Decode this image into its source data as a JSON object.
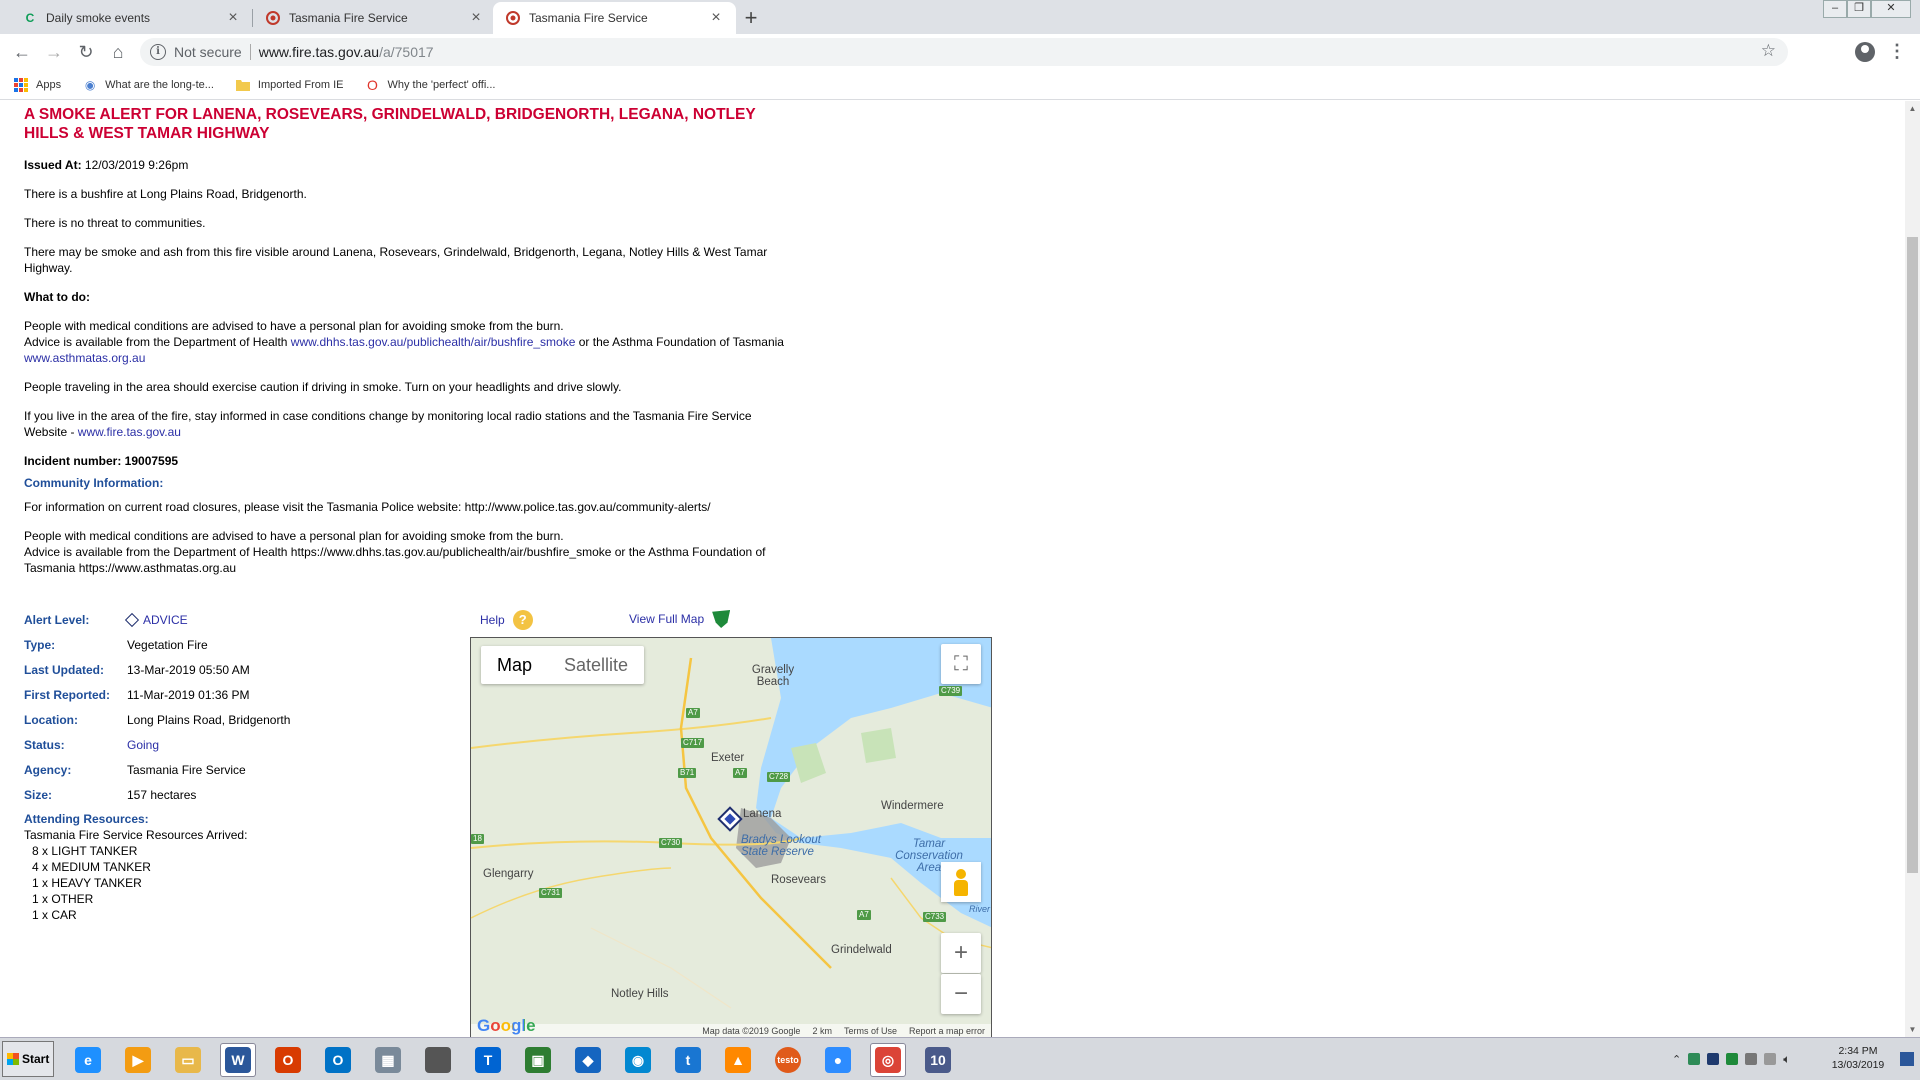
{
  "browser": {
    "tabs": [
      {
        "title": "Daily smoke events",
        "favicon": "C",
        "favicon_color": "#0f9d58",
        "active": false
      },
      {
        "title": "Tasmania Fire Service",
        "favicon": "tfs-icon",
        "favicon_color": "#c0392b",
        "active": false
      },
      {
        "title": "Tasmania Fire Service",
        "favicon": "tfs-icon",
        "favicon_color": "#c0392b",
        "active": true
      }
    ],
    "new_tab": "+",
    "security_text": "Not secure",
    "url_host": "www.fire.tas.gov.au",
    "url_path": "/a/75017",
    "bookmarks": [
      {
        "label": "Apps",
        "icon": "apps-grid-icon"
      },
      {
        "label": "What are the long-te...",
        "icon": "globe-icon"
      },
      {
        "label": "Imported From IE",
        "icon": "folder-icon"
      },
      {
        "label": "Why the 'perfect' offi...",
        "icon": "opera-icon"
      }
    ]
  },
  "alert": {
    "title": "A SMOKE ALERT FOR LANENA, ROSEVEARS, GRINDELWALD, BRIDGENORTH, LEGANA, NOTLEY HILLS & WEST TAMAR HIGHWAY",
    "issued_label": "Issued At:",
    "issued_value": "12/03/2019 9:26pm",
    "para1": "There is a bushfire at Long Plains Road, Bridgenorth.",
    "para2": "There is no threat to communities.",
    "para3": "There may be smoke and ash from this fire visible around Lanena, Rosevears, Grindelwald, Bridgenorth, Legana, Notley Hills & West Tamar Highway.",
    "what_to_do": "What to do:",
    "medical_1": "People with medical conditions are advised to have a personal plan for avoiding smoke from the burn.",
    "medical_2a": "Advice is available from the Department of Health ",
    "medical_link1": "www.dhhs.tas.gov.au/publichealth/air/bushfire_smoke",
    "medical_2b": " or the Asthma Foundation of Tasmania ",
    "medical_link2": "www.asthmatas.org.au",
    "travel": "People traveling in the area should exercise caution if driving in smoke. Turn on your headlights and drive slowly.",
    "live_a": "If you live in the area of the fire, stay informed in case conditions change by monitoring local radio stations and the Tasmania Fire Service Website - ",
    "live_link": "www.fire.tas.gov.au",
    "incident": "Incident number: 19007595",
    "community_head": "Community Information:",
    "community_1": "For information on current road closures, please visit the Tasmania Police website: http://www.police.tas.gov.au/community-alerts/",
    "community_2": "People with medical conditions are advised to have a personal plan for avoiding smoke from the burn.",
    "community_3": "Advice is available from the Department of Health https://www.dhhs.tas.gov.au/publichealth/air/bushfire_smoke or the Asthma Foundation of Tasmania https://www.asthmatas.org.au"
  },
  "details": [
    {
      "label": "Alert Level:",
      "value": "ADVICE"
    },
    {
      "label": "Type:",
      "value": "Vegetation Fire"
    },
    {
      "label": "Last Updated:",
      "value": "13-Mar-2019 05:50 AM"
    },
    {
      "label": "First Reported:",
      "value": "11-Mar-2019 01:36 PM"
    },
    {
      "label": "Location:",
      "value": "Long Plains Road, Bridgenorth"
    },
    {
      "label": "Status:",
      "value": "Going"
    },
    {
      "label": "Agency:",
      "value": "Tasmania Fire Service"
    },
    {
      "label": "Size:",
      "value": "157 hectares"
    }
  ],
  "resources": {
    "head": "Attending Resources:",
    "sub": "Tasmania Fire Service Resources Arrived:",
    "items": [
      "8 x LIGHT TANKER",
      "4 x MEDIUM TANKER",
      "1 x HEAVY TANKER",
      "1 x OTHER",
      "1 x CAR"
    ]
  },
  "links": {
    "help": "Help",
    "help_glyph": "?",
    "full_map": "View Full Map"
  },
  "map": {
    "toggle_map": "Map",
    "toggle_satellite": "Satellite",
    "zoom_in": "+",
    "zoom_out": "−",
    "fullscreen": "⛶",
    "places": [
      "Gravelly Beach",
      "Exeter",
      "Lanena",
      "Windermere",
      "Bradys Lookout State Reserve",
      "Rosevears",
      "Glengarry",
      "Tamar Conservation Area",
      "Grindelwald",
      "Notley Hills",
      "River"
    ],
    "roads": [
      "A7",
      "C717",
      "B71",
      "A7",
      "C728",
      "C730",
      "18",
      "C731",
      "A7",
      "C733",
      "C739"
    ],
    "logo": "Google",
    "footer": [
      "Map data ©2019 Google",
      "2 km",
      "Terms of Use",
      "Report a map error"
    ]
  },
  "taskbar": {
    "start": "Start",
    "apps": [
      {
        "name": "internet-explorer-icon",
        "glyph": "e",
        "color": "#1e90ff"
      },
      {
        "name": "media-player-icon",
        "glyph": "▶",
        "color": "#f39c12"
      },
      {
        "name": "file-explorer-icon",
        "glyph": "▭",
        "color": "#e8b84a"
      },
      {
        "name": "word-icon",
        "glyph": "W",
        "color": "#2b579a"
      },
      {
        "name": "office-icon",
        "glyph": "O",
        "color": "#d83b01"
      },
      {
        "name": "outlook-icon",
        "glyph": "O",
        "color": "#0072c6"
      },
      {
        "name": "calculator-icon",
        "glyph": "▦",
        "color": "#7a8a9a"
      },
      {
        "name": "apple-icon",
        "glyph": "",
        "color": "#555555"
      },
      {
        "name": "telstra-icon",
        "glyph": "T",
        "color": "#0064d2"
      },
      {
        "name": "app-icon",
        "glyph": "▣",
        "color": "#2e7d32"
      },
      {
        "name": "cube-icon",
        "glyph": "◆",
        "color": "#1565c0"
      },
      {
        "name": "camera-icon",
        "glyph": "◉",
        "color": "#0288d1"
      },
      {
        "name": "t-app-icon",
        "glyph": "t",
        "color": "#1976d2"
      },
      {
        "name": "vlc-icon",
        "glyph": "▲",
        "color": "#ff8800"
      },
      {
        "name": "testo-icon",
        "glyph": "testo",
        "color": "#e05a1a"
      },
      {
        "name": "zoom-icon",
        "glyph": "●",
        "color": "#2d8cff"
      },
      {
        "name": "chrome-icon",
        "glyph": "◎",
        "color": "#db4437"
      },
      {
        "name": "winrar-icon",
        "glyph": "10",
        "color": "#4a5a8a"
      }
    ],
    "clock_time": "2:34 PM",
    "clock_date": "13/03/2019"
  }
}
